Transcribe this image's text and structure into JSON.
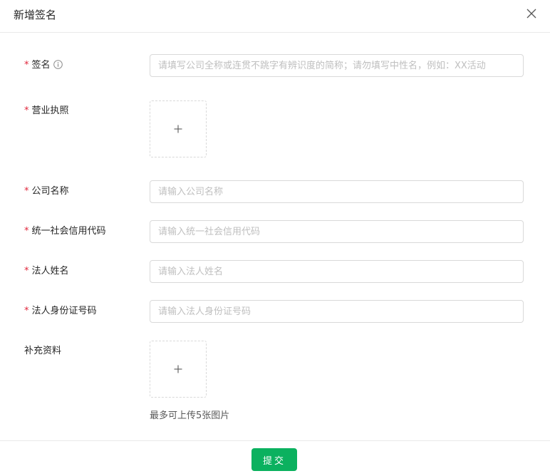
{
  "dialog": {
    "title": "新增签名",
    "close_icon": "close-icon"
  },
  "form": {
    "required_mark": "*",
    "signature": {
      "label": "签名",
      "placeholder": "请填写公司全称或连贯不跳字有辨识度的简称；请勿填写中性名，例如：XX活动",
      "value": "",
      "icon": "info-icon"
    },
    "business_license": {
      "label": "营业执照",
      "icon": "plus-icon"
    },
    "company_name": {
      "label": "公司名称",
      "placeholder": "请输入公司名称",
      "value": ""
    },
    "credit_code": {
      "label": "统一社会信用代码",
      "placeholder": "请输入统一社会信用代码",
      "value": ""
    },
    "legal_name": {
      "label": "法人姓名",
      "placeholder": "请输入法人姓名",
      "value": ""
    },
    "legal_id": {
      "label": "法人身份证号码",
      "placeholder": "请输入法人身份证号码",
      "value": ""
    },
    "supplementary": {
      "label": "补充资料",
      "icon": "plus-icon",
      "hint": "最多可上传5张图片"
    }
  },
  "footer": {
    "submit_label": "提交"
  },
  "colors": {
    "primary": "#0bb15f",
    "required": "#e0263b",
    "border": "#d9d9d9",
    "placeholder": "#bfbfbf"
  }
}
